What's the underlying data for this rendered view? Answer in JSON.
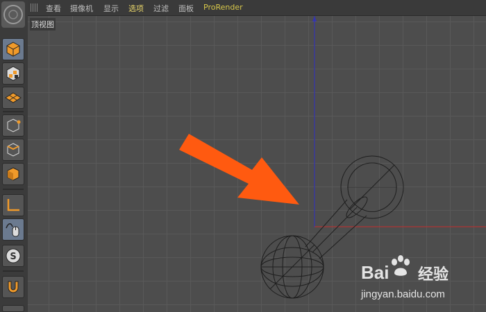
{
  "menubar": {
    "items": [
      "查看",
      "摄像机",
      "显示",
      "选项",
      "过滤",
      "面板",
      "ProRender"
    ],
    "active_item": "选项"
  },
  "viewport": {
    "label": "顶视图"
  },
  "palette": {
    "tools": [
      "cube-tool-icon",
      "checker-texture-icon",
      "grid-plane-icon",
      "point-mode-icon",
      "edge-mode-icon",
      "polygon-mode-icon",
      "axis-icon",
      "tweak-mouse-icon",
      "snap-s-icon",
      "magnet-icon"
    ]
  },
  "watermark": {
    "brand": "Bai",
    "brand_suffix": "经验",
    "url": "jingyan.baidu.com"
  },
  "colors": {
    "axis_y": "#3a3aa8",
    "axis_x": "#a83a3a",
    "arrow": "#ff5a10",
    "accent_orange": "#f09a2a",
    "menu_highlight": "#e8d56a"
  }
}
